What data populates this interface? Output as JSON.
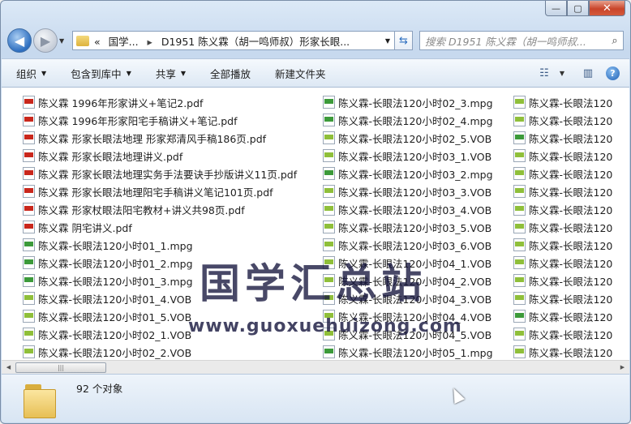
{
  "window": {
    "controls": {
      "minimize": "—",
      "maximize": "▢",
      "close": "✕"
    }
  },
  "navigation": {
    "back_glyph": "◀",
    "forward_glyph": "▶",
    "history_glyph": "▼",
    "address": {
      "overflow": "«",
      "crumb_parent": "国学...",
      "crumb_current": "D1951 陈义霖（胡一鸣师叔）形家长眼..."
    },
    "refresh_glyph": "⇆",
    "search_placeholder": "搜索 D1951 陈义霖（胡一鸣师叔...",
    "search_icon": "search-icon"
  },
  "toolbar": {
    "organize": "组织",
    "include_in_library": "包含到库中",
    "share": "共享",
    "play_all": "全部播放",
    "new_folder": "新建文件夹",
    "help": "?"
  },
  "columns": [
    [
      {
        "name": "陈义霖 1996年形家讲义+笔记2.pdf",
        "type": "pdf"
      },
      {
        "name": "陈义霖 1996年形家阳宅手稿讲义+笔记.pdf",
        "type": "pdf"
      },
      {
        "name": "陈义霖 形家长眼法地理 形家郑清风手稿186页.pdf",
        "type": "pdf"
      },
      {
        "name": "陈义霖 形家长眼法地理讲义.pdf",
        "type": "pdf"
      },
      {
        "name": "陈义霖 形家长眼法地理实务手法要诀手抄版讲义11页.pdf",
        "type": "pdf"
      },
      {
        "name": "陈义霖 形家长眼法地理阳宅手稿讲义笔记101页.pdf",
        "type": "pdf"
      },
      {
        "name": "陈义霖 形家杖眼法阳宅教材+讲义共98页.pdf",
        "type": "pdf"
      },
      {
        "name": "陈义霖 阴宅讲义.pdf",
        "type": "pdf"
      },
      {
        "name": "陈义霖-长眼法120小时01_1.mpg",
        "type": "mpg"
      },
      {
        "name": "陈义霖-长眼法120小时01_2.mpg",
        "type": "mpg"
      },
      {
        "name": "陈义霖-长眼法120小时01_3.mpg",
        "type": "mpg"
      },
      {
        "name": "陈义霖-长眼法120小时01_4.VOB",
        "type": "vob"
      },
      {
        "name": "陈义霖-长眼法120小时01_5.VOB",
        "type": "vob"
      },
      {
        "name": "陈义霖-长眼法120小时02_1.VOB",
        "type": "vob"
      },
      {
        "name": "陈义霖-长眼法120小时02_2.VOB",
        "type": "vob"
      }
    ],
    [
      {
        "name": "陈义霖-长眼法120小时02_3.mpg",
        "type": "mpg"
      },
      {
        "name": "陈义霖-长眼法120小时02_4.mpg",
        "type": "mpg"
      },
      {
        "name": "陈义霖-长眼法120小时02_5.VOB",
        "type": "vob"
      },
      {
        "name": "陈义霖-长眼法120小时03_1.VOB",
        "type": "vob"
      },
      {
        "name": "陈义霖-长眼法120小时03_2.mpg",
        "type": "mpg"
      },
      {
        "name": "陈义霖-长眼法120小时03_3.VOB",
        "type": "vob"
      },
      {
        "name": "陈义霖-长眼法120小时03_4.VOB",
        "type": "vob"
      },
      {
        "name": "陈义霖-长眼法120小时03_5.VOB",
        "type": "vob"
      },
      {
        "name": "陈义霖-长眼法120小时03_6.VOB",
        "type": "vob"
      },
      {
        "name": "陈义霖-长眼法120小时04_1.VOB",
        "type": "vob"
      },
      {
        "name": "陈义霖-长眼法120小时04_2.VOB",
        "type": "vob"
      },
      {
        "name": "陈义霖-长眼法120小时04_3.VOB",
        "type": "vob"
      },
      {
        "name": "陈义霖-长眼法120小时04_4.VOB",
        "type": "vob"
      },
      {
        "name": "陈义霖-长眼法120小时04_5.VOB",
        "type": "vob"
      },
      {
        "name": "陈义霖-长眼法120小时05_1.mpg",
        "type": "mpg"
      }
    ],
    [
      {
        "name": "陈义霖-长眼法120",
        "type": "vob"
      },
      {
        "name": "陈义霖-长眼法120",
        "type": "vob"
      },
      {
        "name": "陈义霖-长眼法120",
        "type": "mpg"
      },
      {
        "name": "陈义霖-长眼法120",
        "type": "vob"
      },
      {
        "name": "陈义霖-长眼法120",
        "type": "vob"
      },
      {
        "name": "陈义霖-长眼法120",
        "type": "vob"
      },
      {
        "name": "陈义霖-长眼法120",
        "type": "vob"
      },
      {
        "name": "陈义霖-长眼法120",
        "type": "vob"
      },
      {
        "name": "陈义霖-长眼法120",
        "type": "vob"
      },
      {
        "name": "陈义霖-长眼法120",
        "type": "vob"
      },
      {
        "name": "陈义霖-长眼法120",
        "type": "vob"
      },
      {
        "name": "陈义霖-长眼法120",
        "type": "vob"
      },
      {
        "name": "陈义霖-长眼法120",
        "type": "mpg"
      },
      {
        "name": "陈义霖-长眼法120",
        "type": "vob"
      },
      {
        "name": "陈义霖-长眼法120",
        "type": "vob"
      }
    ]
  ],
  "watermark": {
    "title": "国学汇总站",
    "url": "www.guoxuehuizong.com"
  },
  "scrollbar": {
    "left_glyph": "◀",
    "right_glyph": "▶",
    "thumb_grip": "|||"
  },
  "status": {
    "item_count": "92 个对象"
  },
  "colors": {
    "pdf": "#c9271c",
    "mpg": "#3c9a3a",
    "vob": "#8fbf3a"
  }
}
